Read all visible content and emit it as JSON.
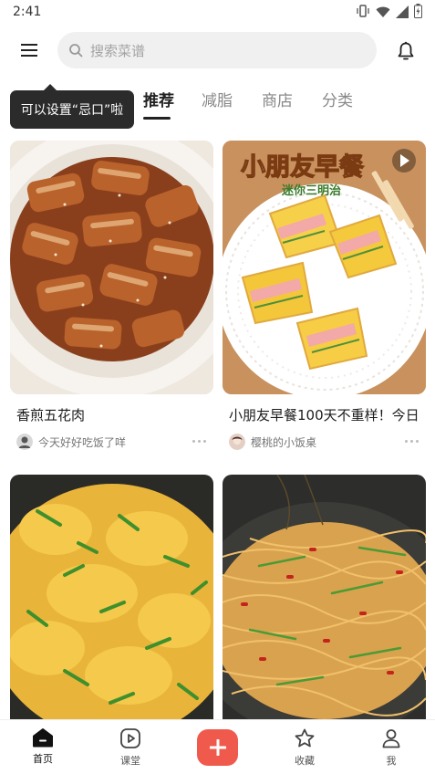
{
  "status_bar": {
    "time": "2:41"
  },
  "header": {
    "search_placeholder": "搜索菜谱"
  },
  "tooltip": {
    "text": "可以设置“忌口”啦"
  },
  "tabs": [
    {
      "label": "推荐",
      "active": true
    },
    {
      "label": "减脂",
      "active": false
    },
    {
      "label": "商店",
      "active": false
    },
    {
      "label": "分类",
      "active": false
    }
  ],
  "feed": [
    {
      "title": "香煎五花肉",
      "author": "今天好好吃饭了咩",
      "image": "pan-fried pork belly"
    },
    {
      "title": "小朋友早餐100天不重样！今日",
      "author": "樱桃的小饭桌",
      "image": "kids breakfast mini sandwiches",
      "image_text": {
        "heading": "小朋友早餐",
        "sub": "迷你三明治"
      }
    },
    {
      "title": "",
      "author": "",
      "image": "scrambled eggs with chives"
    },
    {
      "title": "",
      "author": "",
      "image": "shredded potato stir-fry with chili"
    }
  ],
  "bottom_nav": [
    {
      "label": "首页",
      "icon": "home-icon",
      "active": true
    },
    {
      "label": "课堂",
      "icon": "play-icon",
      "active": false
    },
    {
      "label": "收藏",
      "icon": "star-icon",
      "active": false
    },
    {
      "label": "我",
      "icon": "person-icon",
      "active": false
    }
  ],
  "colors": {
    "accent": "#f05a4d",
    "tooltip_bg": "#2b2b2b",
    "search_bg": "#f0f0f0"
  }
}
